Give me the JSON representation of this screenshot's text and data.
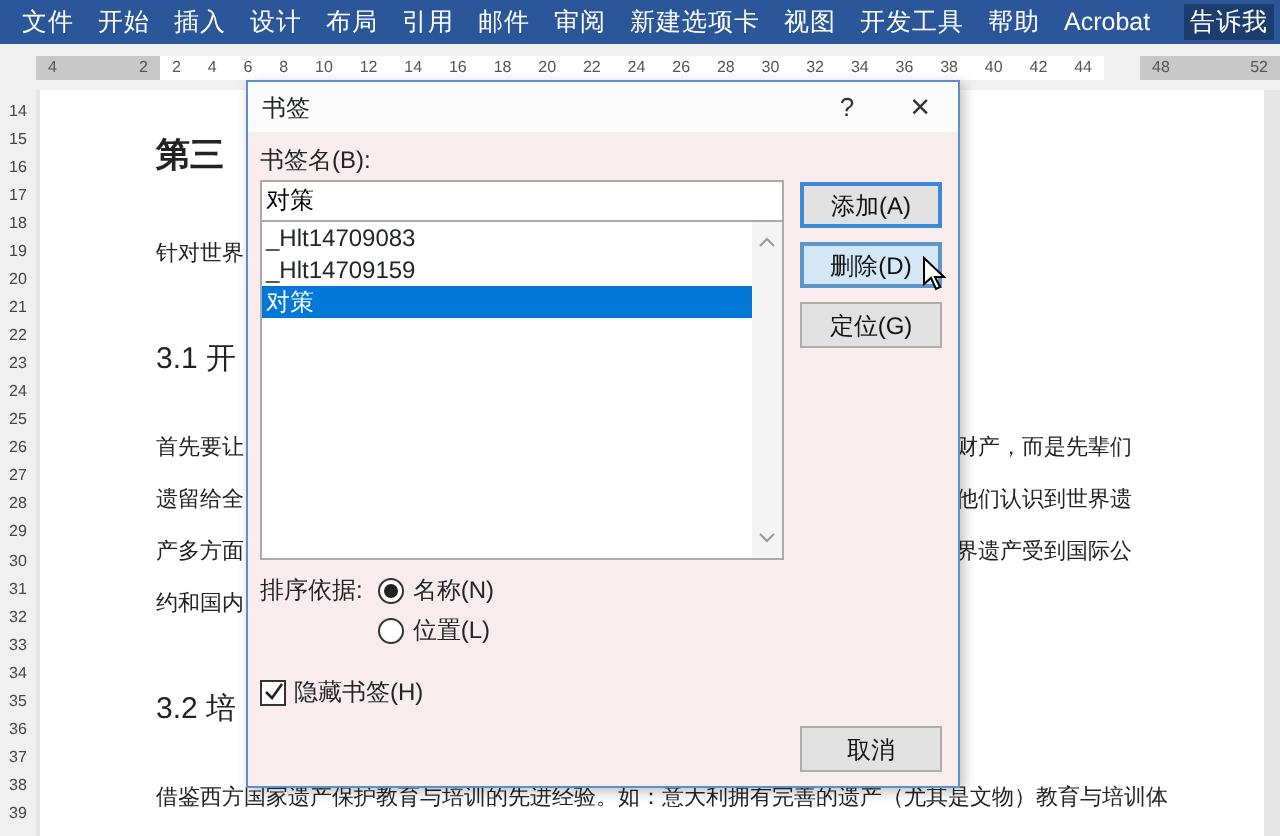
{
  "menu": {
    "tabs": [
      {
        "label": "文件"
      },
      {
        "label": "开始"
      },
      {
        "label": "插入"
      },
      {
        "label": "设计"
      },
      {
        "label": "布局"
      },
      {
        "label": "引用"
      },
      {
        "label": "邮件"
      },
      {
        "label": "审阅"
      },
      {
        "label": "新建选项卡"
      },
      {
        "label": "视图"
      },
      {
        "label": "开发工具"
      },
      {
        "label": "帮助"
      },
      {
        "label": "Acrobat"
      }
    ],
    "tell_me": "告诉我"
  },
  "ruler": {
    "segments": [
      {
        "margin": true,
        "labels": [
          "4",
          "2"
        ]
      },
      {
        "margin": false,
        "labels": [
          "2",
          "4",
          "6",
          "8",
          "10",
          "12",
          "14",
          "16",
          "18",
          "20",
          "22",
          "24",
          "26",
          "28",
          "30",
          "32",
          "34",
          "36",
          "38",
          "40",
          "42",
          "44"
        ]
      },
      {
        "margin": true,
        "labels": [
          "48",
          "52"
        ]
      }
    ]
  },
  "vertical_ruler": [
    "14",
    "15",
    "16",
    "17",
    "18",
    "19",
    "20",
    "21",
    "22",
    "23",
    "24",
    "25",
    "26",
    "27",
    "28",
    "29",
    "30",
    "31",
    "32",
    "33",
    "34",
    "35",
    "36",
    "37",
    "38",
    "39"
  ],
  "document": {
    "lines": [
      {
        "kind": "heading",
        "left": "第三"
      },
      {
        "kind": "text",
        "left": "针对世界"
      },
      {
        "kind": "subheading",
        "left": "3.1  开"
      },
      {
        "kind": "text",
        "left": "首先要让",
        "right": "财产，而是先辈们"
      },
      {
        "kind": "text",
        "left": "遗留给全",
        "right": "他们认识到世界遗"
      },
      {
        "kind": "text",
        "left": "产多方面",
        "right": "界遗产受到国际公"
      },
      {
        "kind": "text",
        "left": "约和国内"
      },
      {
        "kind": "subheading",
        "left": "3.2  培"
      },
      {
        "kind": "text",
        "full": "借鉴西方国家遗产保护教育与培训的先进经验。如：意大利拥有完善的遗产（尤其是文物）教育与培训体"
      }
    ]
  },
  "dialog": {
    "title": "书签",
    "help": "?",
    "close": "×",
    "name_label": "书签名(B):",
    "name_value": "对策",
    "bookmarks": [
      {
        "label": "_Hlt14709083",
        "selected": false
      },
      {
        "label": "_Hlt14709159",
        "selected": false
      },
      {
        "label": "对策",
        "selected": true
      }
    ],
    "sort_label": "排序依据:",
    "sort_options": [
      {
        "label": "名称(N)",
        "selected": true
      },
      {
        "label": "位置(L)",
        "selected": false
      }
    ],
    "hidden": {
      "label": "隐藏书签(H)",
      "checked": true
    },
    "buttons": [
      {
        "label": "添加(A)",
        "kind": "default"
      },
      {
        "label": "删除(D)",
        "kind": "hover"
      },
      {
        "label": "定位(G)",
        "kind": "normal"
      }
    ],
    "cancel": "取消"
  }
}
